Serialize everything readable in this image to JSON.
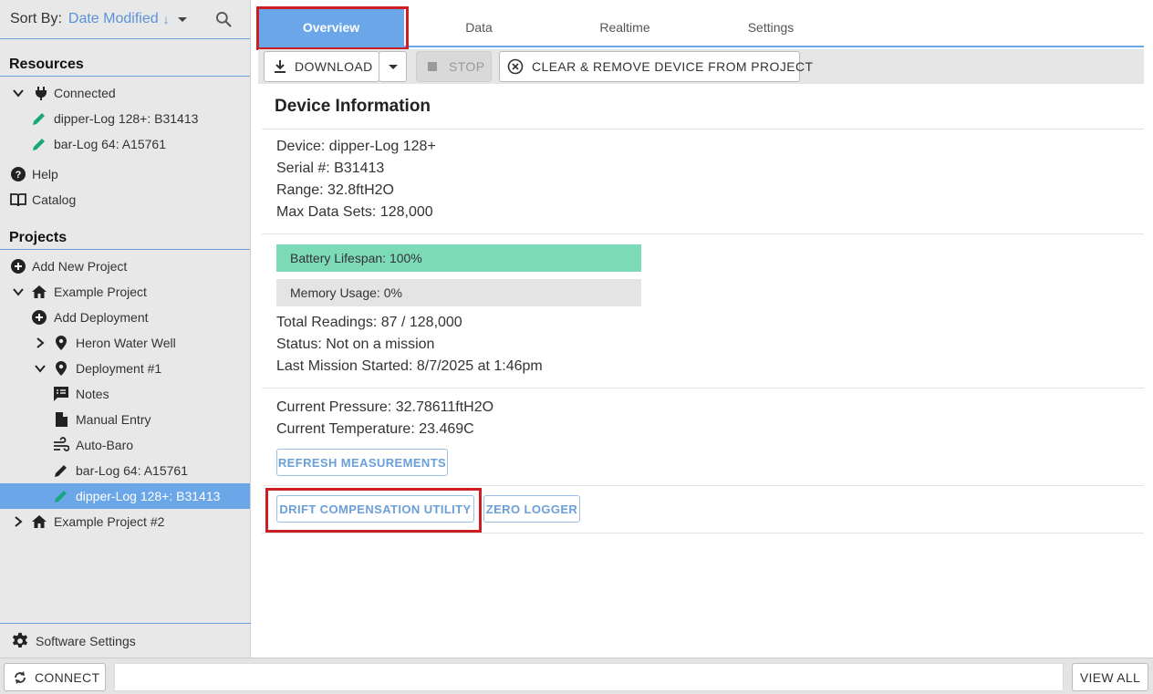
{
  "sort": {
    "label": "Sort By:",
    "value": "Date Modified",
    "direction_glyph": "↓"
  },
  "resources": {
    "title": "Resources",
    "connected_label": "Connected",
    "devices": [
      {
        "label": "dipper-Log 128+: B31413"
      },
      {
        "label": "bar-Log 64: A15761"
      }
    ],
    "help_label": "Help",
    "catalog_label": "Catalog"
  },
  "projects": {
    "title": "Projects",
    "add_new_label": "Add New Project",
    "example_project_label": "Example Project",
    "add_deployment_label": "Add Deployment",
    "heron_label": "Heron Water Well",
    "deployment1_label": "Deployment #1",
    "notes_label": "Notes",
    "manual_entry_label": "Manual Entry",
    "auto_baro_label": "Auto-Baro",
    "barlog_label": "bar-Log 64: A15761",
    "dipperlog_label": "dipper-Log 128+: B31413",
    "example_project2_label": "Example Project #2"
  },
  "software_settings_label": "Software Settings",
  "bottom": {
    "connect_label": "CONNECT",
    "view_all_label": "VIEW ALL"
  },
  "tabs": [
    "Overview",
    "Data",
    "Realtime",
    "Settings"
  ],
  "toolbar": {
    "download_label": "DOWNLOAD",
    "stop_label": "STOP",
    "clear_label": "CLEAR & REMOVE DEVICE FROM PROJECT"
  },
  "device": {
    "title": "Device Information",
    "device_line": "Device: dipper-Log 128+",
    "serial_line": "Serial #: B31413",
    "range_line": "Range: 32.8ftH2O",
    "max_line": "Max Data Sets: 128,000",
    "battery_label": "Battery Lifespan: 100%",
    "battery_fraction": 1.0,
    "memory_label": "Memory Usage: 0%",
    "memory_fraction": 0.0,
    "total_readings": "Total Readings: 87 / 128,000",
    "status": "Status: Not on a mission",
    "last_mission": "Last Mission Started: 8/7/2025 at 1:46pm",
    "current_pressure": "Current Pressure: 32.78611ftH2O",
    "current_temperature": "Current Temperature: 23.469C",
    "refresh_label": "REFRESH MEASUREMENTS",
    "drift_label": "DRIFT COMPENSATION UTILITY",
    "zero_label": "ZERO LOGGER"
  },
  "colors": {
    "accent": "#6aa6e8",
    "battery_fill": "#7ddab9",
    "memory_track": "#e4e4e4",
    "highlight_outline": "#cc1f24",
    "edit_icon_green": "#17a57a"
  }
}
